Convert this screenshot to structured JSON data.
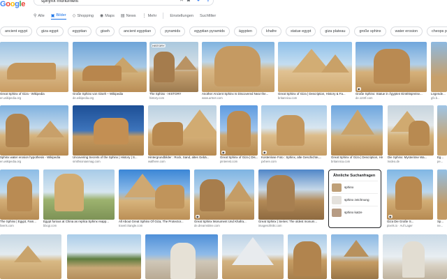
{
  "logo": "Google",
  "search": {
    "value": "sphynx monument"
  },
  "tabs": [
    {
      "label": "Alle",
      "icon": "search-icon"
    },
    {
      "label": "Bilder",
      "icon": "image-icon",
      "active": true
    },
    {
      "label": "Shopping",
      "icon": "tag-icon"
    },
    {
      "label": "Maps",
      "icon": "map-pin-icon"
    },
    {
      "label": "News",
      "icon": "news-icon"
    },
    {
      "label": "Mehr",
      "icon": "more-icon"
    }
  ],
  "tab_extra": [
    "Einstellungen",
    "Suchfilter"
  ],
  "chips": [
    "ancient egypt",
    "giza egypt",
    "egyptian",
    "giseh",
    "ancient egyptian",
    "pyramids",
    "egyptian pyramids",
    "ägypten",
    "khafre",
    "statue egypt",
    "giza plateau",
    "große sphinx",
    "water erosion",
    "cheops pyramide"
  ],
  "rows": [
    {
      "tiles": [
        {
          "caption": "Great Sphinx of Giza - Wikipedia",
          "source": "en.wikipedia.org"
        },
        {
          "caption": "Große Sphinx von Giseh – Wikipedia",
          "source": "de.wikipedia.org"
        },
        {
          "caption": "The Sphinx - HISTORY",
          "source": "history.com",
          "badge": "HISTORY"
        },
        {
          "caption": "Another Ancient Sphinx Is Discovered Near the...",
          "source": "www.artnet.com"
        },
        {
          "caption": "Great Sphinx of Giza | Description, History & Fa...",
          "source": "britannica.com"
        },
        {
          "caption": "Große Sphinx: Statue in Ägypten Eintrittspreise...",
          "source": "de.123rf.com"
        },
        {
          "caption": "Legende...",
          "source": "gfx.b..."
        }
      ]
    },
    {
      "tiles": [
        {
          "caption": "Sphinx water erosion hypothesis - Wikipedia",
          "source": "en.wikipedia.org"
        },
        {
          "caption": "Uncovering Secrets of the Sphinx | History | S...",
          "source": "smithsonianmag.com"
        },
        {
          "caption": "Hintergrundbilder : Rock, Sand, altes Gebä...",
          "source": "wallhere.com"
        },
        {
          "caption": "Great Sphinx of Giza | Dis...",
          "source": "pinterest.com"
        },
        {
          "caption": "Kostenlose Foto : Sphinx, alte Geschichte,...",
          "source": "pxhere.com"
        },
        {
          "caption": "Great Sphinx of Giza | Description, History & Fa...",
          "source": "britannica.com"
        },
        {
          "caption": "Die Sphinx: Mysteriöse Wa...",
          "source": "tvideo.de"
        },
        {
          "caption": "Eg...",
          "source": "pe..."
        }
      ]
    },
    {
      "tiles": [
        {
          "caption": "The Sphinx | Egypt, Fam...",
          "source": "liveris.com"
        },
        {
          "caption": "Egypt furious at China as replica Sphinx reapp...",
          "source": "bbcgi.com"
        },
        {
          "caption": "All About Great Sphinx Of Giza, The Protector...",
          "source": "travel.triangle.com"
        },
        {
          "caption": "Great Sphinx Monument Und Khafra...",
          "source": "de.dreamstime.com"
        },
        {
          "caption": "Great Sphinx | Series: The oldest monum...",
          "source": "imagesofmiki.com"
        },
        {
          "caption": "Die Sphinx von ...",
          "source": "..."
        },
        {
          "caption": "Giza Die Große S...",
          "source": "pixels.io · Auf Lager"
        },
        {
          "caption": "Sp...",
          "source": "ne..."
        }
      ]
    }
  ],
  "related": {
    "title": "Ähnliche Suchanfragen",
    "items": [
      "sphinx",
      "sphinx zeichnung",
      "sphinx katze"
    ]
  },
  "colors": {
    "google_blue": "#4285F4",
    "google_red": "#EA4335",
    "google_yellow": "#FBBC05",
    "google_green": "#34A853",
    "active_tab": "#1a73e8"
  }
}
